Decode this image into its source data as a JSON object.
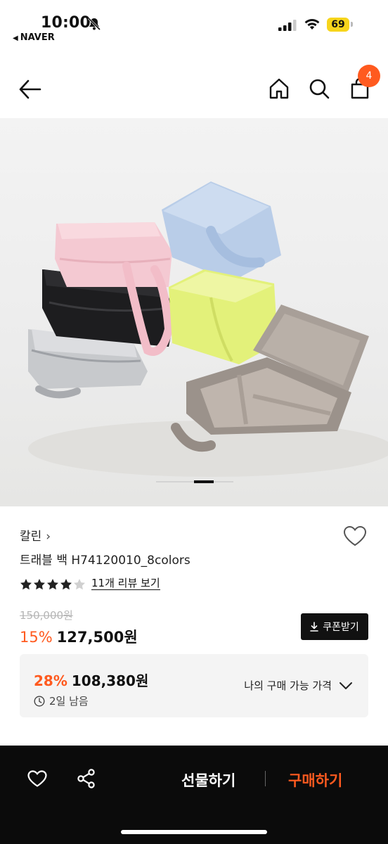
{
  "status_bar": {
    "time": "10:00",
    "back_app": "NAVER",
    "battery": "69"
  },
  "nav": {
    "cart_count": "4"
  },
  "hero": {
    "colors": [
      "#f4c9d2",
      "#b9cde8",
      "#1d1d1f",
      "#e3f17a",
      "#c7c9cc",
      "#a89f98"
    ]
  },
  "product": {
    "brand": "칼린",
    "brand_chevron": "›",
    "title": "트래블 백 H74120010_8colors",
    "rating_stars": 4.5,
    "review_link": "11개 리뷰 보기",
    "original_price": "150,000원",
    "discount_percent": "15%",
    "sale_price": "127,500원",
    "coupon_button": "쿠폰받기",
    "accent_color": "#ff5a1f"
  },
  "benefit": {
    "percent": "28%",
    "price": "108,380원",
    "remaining": "2일 남음",
    "my_price_label": "나의 구매 가능 가격"
  },
  "bottom_bar": {
    "gift_label": "선물하기",
    "buy_label": "구매하기"
  }
}
